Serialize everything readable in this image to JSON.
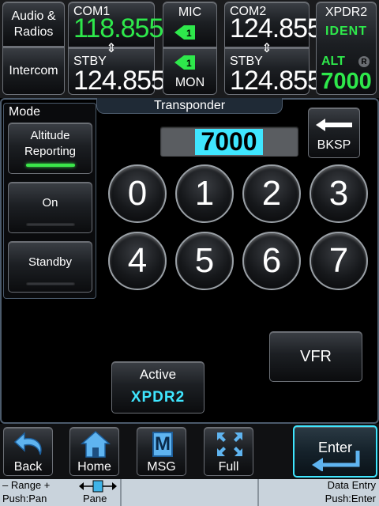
{
  "top_bar": {
    "audio": {
      "line1": "Audio &",
      "line2": "Radios"
    },
    "intercom": "Intercom",
    "com1": {
      "label": "COM1",
      "active": "118.855",
      "stby_label": "STBY",
      "standby": "124.855"
    },
    "mic": {
      "label": "MIC",
      "mon_label": "MON"
    },
    "com2": {
      "label": "COM2",
      "active": "124.855",
      "stby_label": "STBY",
      "standby": "124.855"
    },
    "xpdr": {
      "label": "XPDR2",
      "status": "IDENT",
      "mode": "ALT",
      "reply": "R",
      "code": "7000"
    }
  },
  "mode_panel": {
    "title": "Mode",
    "altitude_reporting": {
      "line1": "Altitude",
      "line2": "Reporting"
    },
    "on": "On",
    "standby": "Standby"
  },
  "transponder": {
    "title": "Transponder",
    "code_display": "7000",
    "bksp": "BKSP",
    "keys": [
      "0",
      "1",
      "2",
      "3",
      "4",
      "5",
      "6",
      "7"
    ],
    "vfr": "VFR",
    "active": {
      "label": "Active",
      "value": "XPDR2"
    }
  },
  "bottom_bar": {
    "back": "Back",
    "home": "Home",
    "msg": "MSG",
    "msg_icon": "M",
    "full": "Full",
    "enter": "Enter"
  },
  "knob_labels": {
    "range": "– Range +",
    "push_pan": "Push:Pan",
    "pane": "Pane",
    "data_entry": "Data Entry",
    "push_enter": "Push:Enter"
  },
  "colors": {
    "green": "#2ee84b",
    "cyan": "#3fe6ff",
    "panel_border": "#4b5a6b"
  }
}
